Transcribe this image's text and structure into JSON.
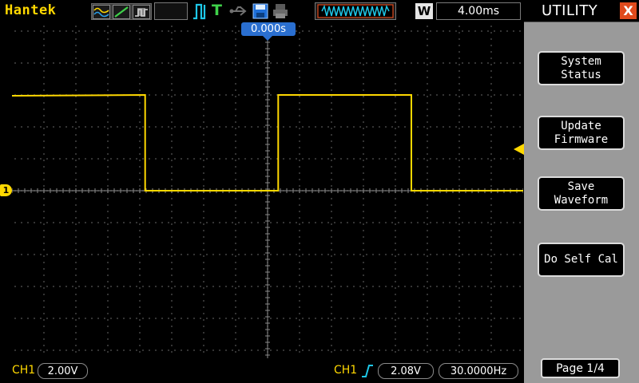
{
  "topbar": {
    "brand": "Hantek",
    "run_state": "T",
    "time_offset_label": "W",
    "timebase": "4.00ms"
  },
  "screen": {
    "trigger_position": "0.000s",
    "ch1_marker": "1"
  },
  "bottombar": {
    "ch1_label": "CH1",
    "ch1_scale": "2.00V",
    "trigger_source": "CH1",
    "trigger_level": "2.08V",
    "frequency": "30.0000Hz"
  },
  "menu": {
    "title": "UTILITY",
    "close": "X",
    "buttons": [
      {
        "line1": "System",
        "line2": "Status"
      },
      {
        "line1": "Update",
        "line2": "Firmware"
      },
      {
        "line1": "Save",
        "line2": "Waveform"
      },
      {
        "line1": "Do Self Cal",
        "line2": ""
      }
    ],
    "page": "Page 1/4"
  },
  "colors": {
    "channel1": "#ffd800",
    "accent": "#2a6fd0",
    "menu_bg": "#9a9a9a",
    "close_bg": "#e04a1c"
  },
  "waveform": {
    "type": "square",
    "frequency_hz": 30,
    "volts_per_div": 2.0,
    "time_per_div_ms": 4.0,
    "high_volts": 6.0,
    "low_volts": 0.0,
    "duty_cycle": 0.5,
    "start_phase_divs": 0
  },
  "icons": {
    "mode_1": "wave-mode-icon",
    "mode_2": "line-mode-icon",
    "mode_3": "persist-mode-icon",
    "run": "pulse-run-icon",
    "usb": "usb-icon",
    "save": "floppy-save-icon",
    "print": "printer-icon",
    "buffer": "waveform-buffer-icon",
    "trigger_edge": "rising-edge-icon"
  }
}
